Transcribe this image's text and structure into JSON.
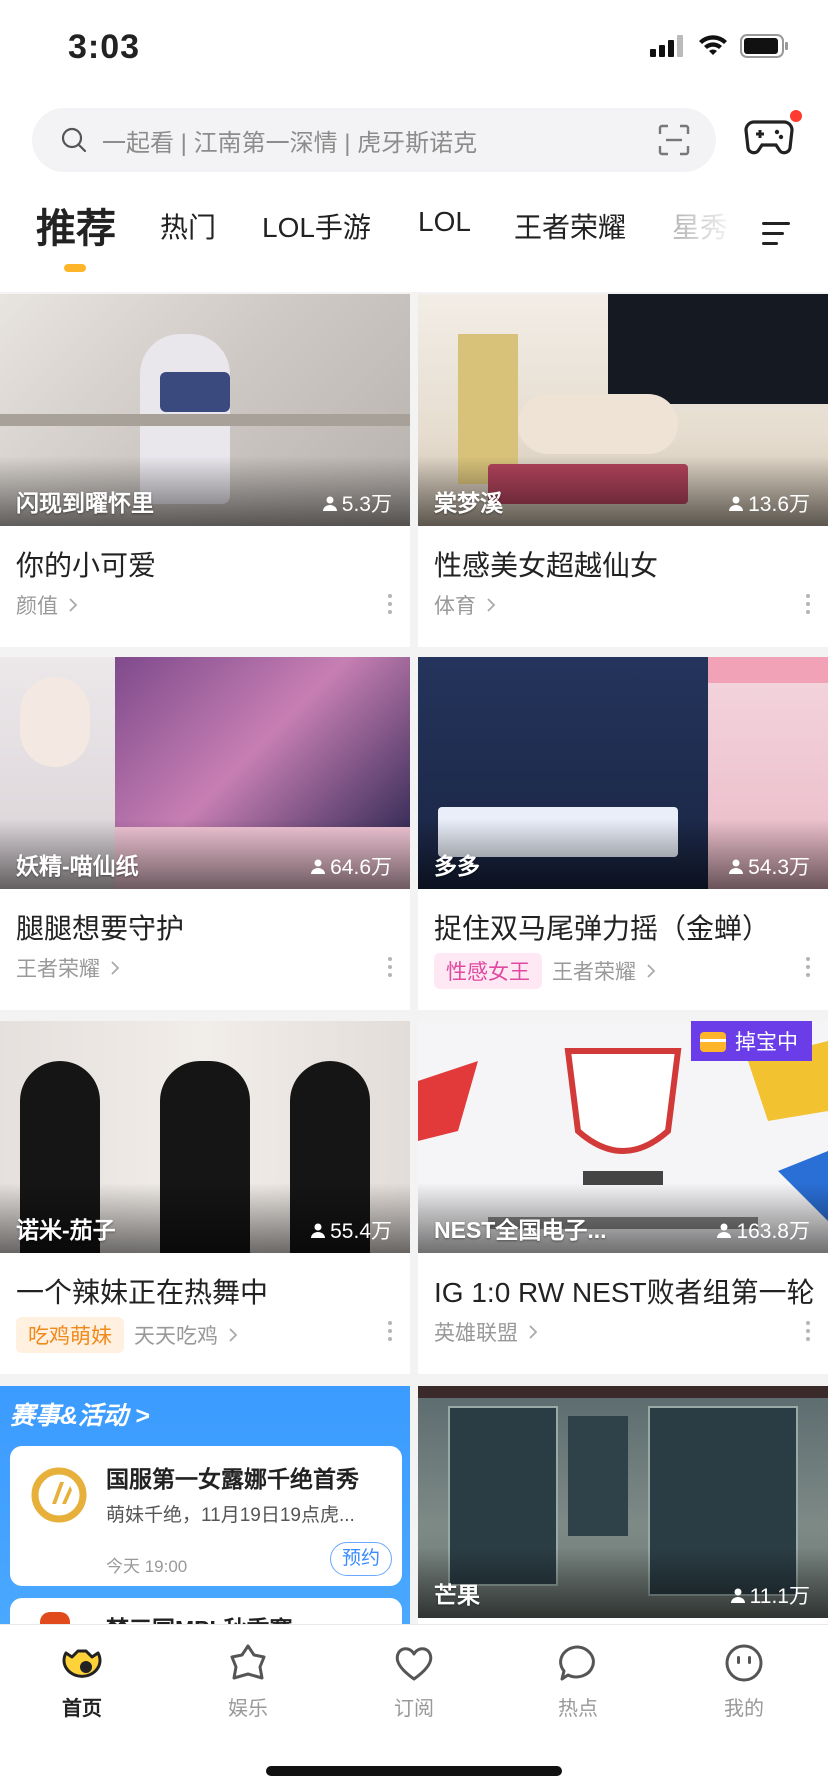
{
  "status_bar": {
    "time": "3:03"
  },
  "search": {
    "placeholder": "一起看 | 江南第一深情 | 虎牙斯诺克"
  },
  "tabs": [
    {
      "label": "推荐",
      "active": true
    },
    {
      "label": "热门"
    },
    {
      "label": "LOL手游"
    },
    {
      "label": "LOL"
    },
    {
      "label": "王者荣耀"
    },
    {
      "label": "星秀"
    }
  ],
  "cards": [
    {
      "streamer": "闪现到曜怀里",
      "viewers": "5.3万",
      "title": "你的小可爱",
      "category": "颜值",
      "tag": ""
    },
    {
      "streamer": "棠梦溪",
      "viewers": "13.6万",
      "title": "性感美女超越仙女",
      "category": "体育",
      "tag": ""
    },
    {
      "streamer": "妖精-喵仙纸",
      "viewers": "64.6万",
      "title": "腿腿想要守护",
      "category": "王者荣耀",
      "tag": ""
    },
    {
      "streamer": "多多",
      "viewers": "54.3万",
      "title": "捉住双马尾弹力摇（金蝉）",
      "category": "王者荣耀",
      "tag": "性感女王"
    },
    {
      "streamer": "诺米-茄子",
      "viewers": "55.4万",
      "title": "一个辣妹正在热舞中",
      "category": "天天吃鸡",
      "tag": "吃鸡萌妹"
    },
    {
      "streamer": "NEST全国电子...",
      "viewers": "163.8万",
      "title": "IG 1:0 RW NEST败者组第一轮",
      "category": "英雄联盟",
      "tag": "",
      "badge": "掉宝中"
    },
    {
      "streamer": "芒果",
      "viewers": "11.1万"
    }
  ],
  "event_panel": {
    "header": "赛事&活动 >",
    "item1": {
      "title": "国服第一女露娜千绝首秀",
      "desc": "萌妹千绝，11月19日19点虎...",
      "time": "今天 19:00",
      "button": "预约"
    },
    "item2": {
      "title": "梦三国MPL秋季赛"
    }
  },
  "bottom_nav": [
    {
      "label": "首页",
      "active": true
    },
    {
      "label": "娱乐"
    },
    {
      "label": "订阅"
    },
    {
      "label": "热点"
    },
    {
      "label": "我的"
    }
  ],
  "colors": {
    "accent": "#ffb52a",
    "pink_tag_bg": "#fde8f4",
    "pink_tag_fg": "#e04aa0",
    "orange_tag_bg": "#fff0e0",
    "orange_tag_fg": "#f08a1c",
    "badge": "#6a3de8"
  }
}
